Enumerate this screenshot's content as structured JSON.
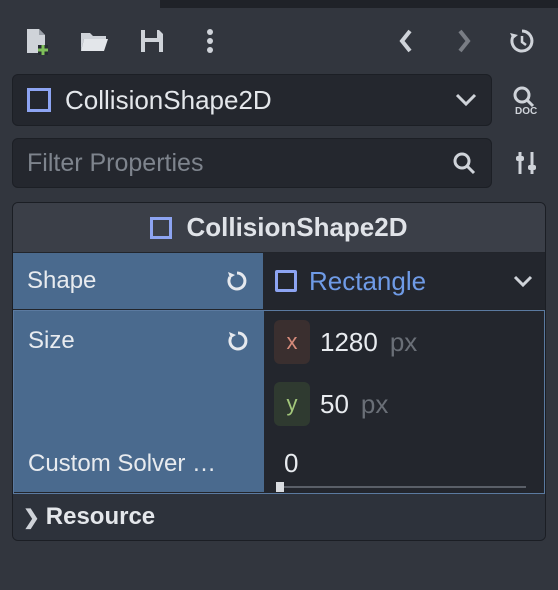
{
  "toolbar": {
    "icons": {
      "new": "new-file-icon",
      "open": "folder-open-icon",
      "save": "save-icon",
      "menu": "kebab-menu-icon",
      "prev": "chevron-left-icon",
      "next": "chevron-right-icon",
      "history": "history-icon"
    }
  },
  "node": {
    "name": "CollisionShape2D",
    "doc_label": "DOC"
  },
  "filter": {
    "placeholder": "Filter Properties",
    "value": ""
  },
  "section": {
    "title": "CollisionShape2D"
  },
  "props": {
    "shape": {
      "label": "Shape",
      "value": "Rectangle"
    },
    "size": {
      "label": "Size",
      "x": "1280",
      "y": "50",
      "unit": "px"
    },
    "custom_solver": {
      "label": "Custom Solver …",
      "value": "0"
    },
    "resource": {
      "label": "Resource"
    }
  }
}
